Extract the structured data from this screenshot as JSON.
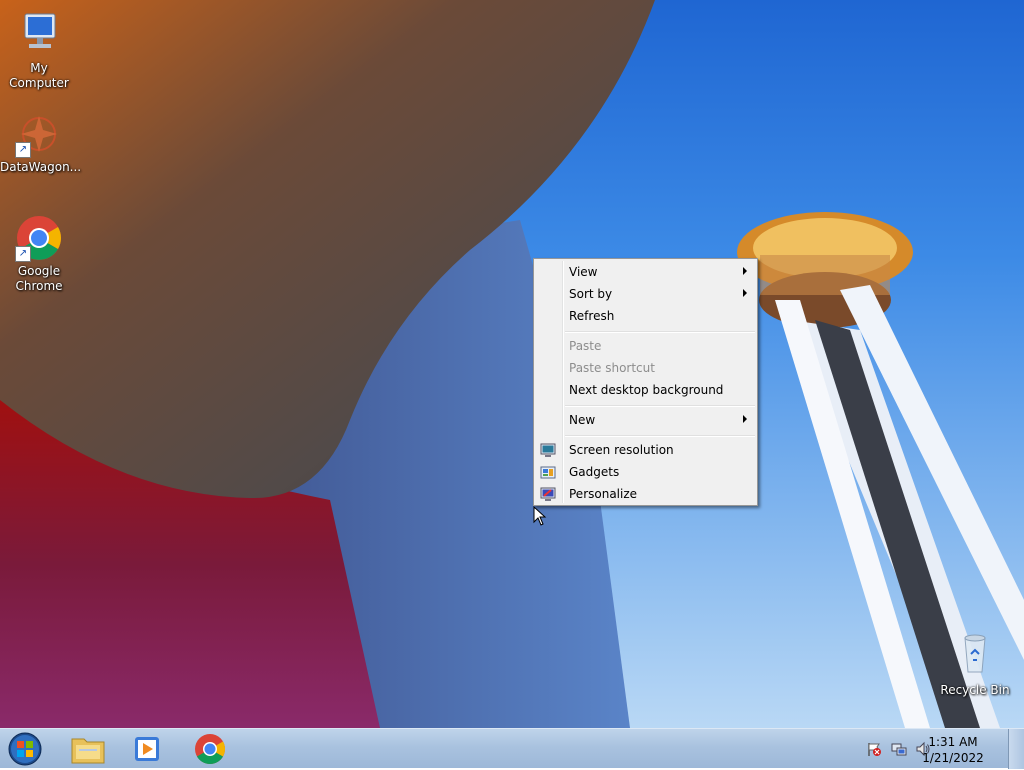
{
  "desktop": {
    "icons": [
      {
        "label": "My Computer"
      },
      {
        "label": "DataWagon..."
      },
      {
        "label": "Google Chrome"
      },
      {
        "label": "Recycle Bin"
      }
    ]
  },
  "context_menu": {
    "items": [
      {
        "label": "View",
        "submenu": true,
        "enabled": true
      },
      {
        "label": "Sort by",
        "submenu": true,
        "enabled": true
      },
      {
        "label": "Refresh",
        "enabled": true
      },
      {
        "label": "Paste",
        "enabled": false
      },
      {
        "label": "Paste shortcut",
        "enabled": false
      },
      {
        "label": "Next desktop background",
        "enabled": true
      },
      {
        "label": "New",
        "submenu": true,
        "enabled": true
      },
      {
        "label": "Screen resolution",
        "icon": "display-icon",
        "enabled": true
      },
      {
        "label": "Gadgets",
        "icon": "gadgets-icon",
        "enabled": true
      },
      {
        "label": "Personalize",
        "icon": "personalize-icon",
        "enabled": true
      }
    ]
  },
  "taskbar": {
    "pinned": [
      "start-orb-icon",
      "file-explorer-icon",
      "media-player-icon",
      "chrome-icon"
    ],
    "tray_icons": [
      "action-center-flag-icon",
      "network-icon",
      "volume-icon"
    ],
    "clock": {
      "time": "1:31 AM",
      "date": "1/21/2022"
    }
  },
  "colors": {
    "menu_bg": "#f0f0f0",
    "taskbar": "#a9c2df",
    "sky": "#3c8ae6"
  }
}
